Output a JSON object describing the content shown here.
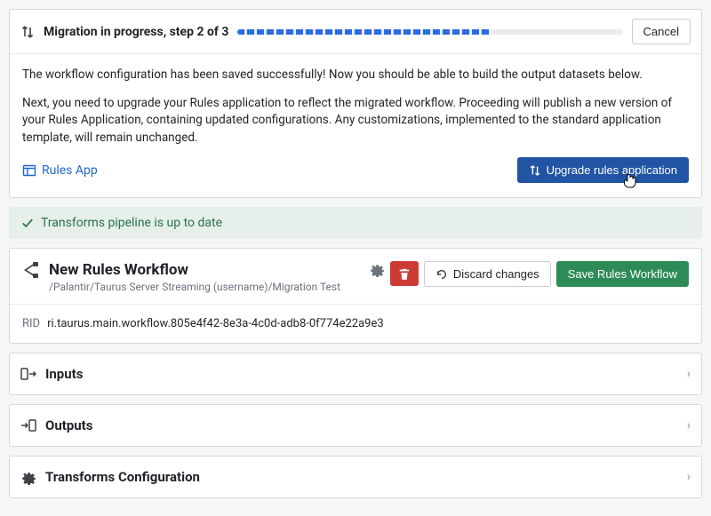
{
  "progress": {
    "title": "Migration in progress, step 2 of 3",
    "cancel_label": "Cancel"
  },
  "message": {
    "p1": "The workflow configuration has been saved successfully! Now you should be able to build the output datasets below.",
    "p2": "Next, you need to upgrade your Rules application to reflect the migrated workflow. Proceeding will publish a new version of your Rules Application, containing updated configurations. Any customizations, implemented to the standard application template, will remain unchanged."
  },
  "links": {
    "rules_app": "Rules App",
    "upgrade_button": "Upgrade rules application"
  },
  "status": {
    "pipeline_uptodate": "Transforms pipeline is up to date"
  },
  "workflow": {
    "title": "New Rules Workflow",
    "path": "/Palantir/Taurus Server Streaming (username)/Migration Test",
    "discard_label": "Discard changes",
    "save_label": "Save Rules Workflow",
    "rid_label": "RID",
    "rid_value": "ri.taurus.main.workflow.805e4f42-8e3a-4c0d-adb8-0f774e22a9e3"
  },
  "sections": {
    "inputs": "Inputs",
    "outputs": "Outputs",
    "transforms": "Transforms Configuration"
  }
}
